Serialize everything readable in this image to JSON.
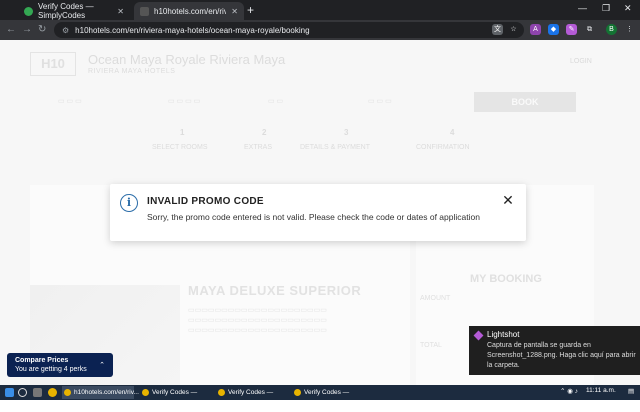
{
  "browser": {
    "tabs": [
      {
        "title": "Verify Codes — SimplyCodes",
        "active": false
      },
      {
        "title": "h10hotels.com/en/riviera-may...",
        "active": true
      }
    ],
    "url": "h10hotels.com/en/riviera-maya-hotels/ocean-maya-royale/booking",
    "profile_initial": "B"
  },
  "page": {
    "logo": "H10",
    "hotel_name": "Ocean Maya Royale Riviera Maya",
    "hotel_location": "RIVIERA MAYA HOTELS",
    "login": "LOGIN",
    "book_label": "BOOK",
    "steps": [
      "SELECT ROOMS",
      "EXTRAS",
      "DETAILS & PAYMENT",
      "CONFIRMATION"
    ],
    "room_title": "MAYA DELUXE SUPERIOR",
    "summary_title": "MY BOOKING",
    "amount_label": "AMOUNT",
    "total_label": "TOTAL"
  },
  "modal": {
    "icon": "info-icon",
    "title": "INVALID PROMO CODE",
    "message": "Sorry, the promo code entered is not valid. Please check the code or dates of application"
  },
  "compare_prices": {
    "title": "Compare Prices",
    "subtitle": "You are getting 4 perks"
  },
  "toast": {
    "title": "Lightshot",
    "message": "Captura de pantalla se guarda en Screenshot_1288.png. Haga clic aquí para abrir la carpeta."
  },
  "taskbar": {
    "apps": [
      "h10hotels.com/en/riv...",
      "Verify Codes — Simp...",
      "Verify Codes — Simp...",
      "Verify Codes — Simp..."
    ],
    "time": "11:11 a.m."
  },
  "colors": {
    "accent": "#2a6ca8",
    "compare_bg": "#0b2252",
    "chrome_dark": "#202124"
  }
}
